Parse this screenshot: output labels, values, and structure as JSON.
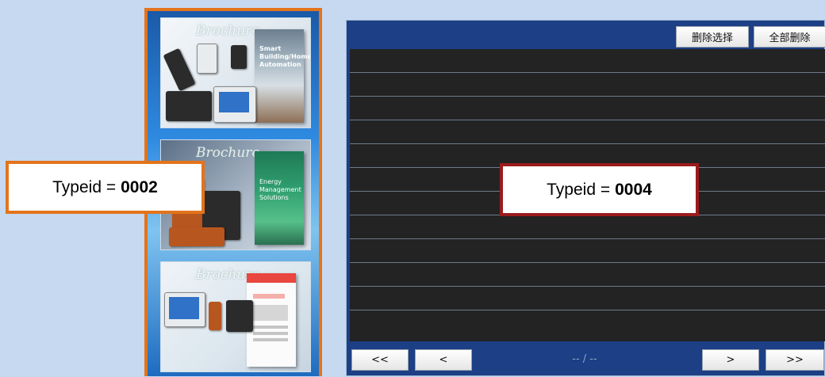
{
  "brochures": [
    {
      "title": "Brochure",
      "book_text": "Smart Building/Home Automation"
    },
    {
      "title": "Brochure",
      "book_text": "Energy Management Solutions"
    },
    {
      "title": "Brochure",
      "book_text": ""
    }
  ],
  "panel": {
    "delete_selected_label": "删除选择",
    "delete_all_label": "全部删除",
    "rows": 12
  },
  "pager": {
    "first_label": "<<",
    "prev_label": "<",
    "page_text": "-- / --",
    "next_label": ">",
    "last_label": ">>"
  },
  "annotations": {
    "left": {
      "label": "Typeid =",
      "value": "0002"
    },
    "center": {
      "label": "Typeid =",
      "value": "0004"
    }
  },
  "colors": {
    "annotation_left_border": "#e3741c",
    "annotation_center_border": "#9b1b1b",
    "panel_bg": "#1c3f85",
    "list_bg": "#232323",
    "page_bg": "#c6d9f1"
  }
}
